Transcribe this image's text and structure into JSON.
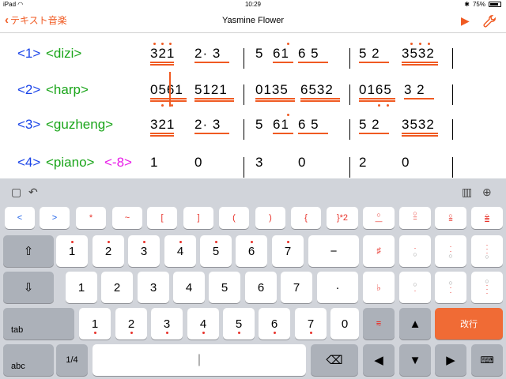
{
  "status": {
    "device": "iPad",
    "wifi": "wifi-icon",
    "time": "10:29",
    "bluetooth": "bluetooth-icon",
    "battery": "75%"
  },
  "nav": {
    "back_label": "テキスト音楽",
    "title": "Yasmine Flower",
    "play_icon": "play-icon",
    "settings_icon": "wrench-icon"
  },
  "accent": "#f05a22",
  "score": {
    "rows": [
      {
        "num": "<1>",
        "name": "<dizi>",
        "extra": "",
        "measures": [
          [
            "321",
            "2· 3"
          ],
          [
            "5",
            "61",
            "6 5"
          ],
          [
            "5 2",
            "3532"
          ]
        ]
      },
      {
        "num": "<2>",
        "name": "<harp>",
        "extra": "",
        "measures": [
          [
            "0561",
            "5121"
          ],
          [
            "0135",
            "6532"
          ],
          [
            "0165",
            "3 2"
          ]
        ]
      },
      {
        "num": "<3>",
        "name": "<guzheng>",
        "extra": "",
        "measures": [
          [
            "321",
            "2· 3"
          ],
          [
            "5",
            "61",
            "6 5"
          ],
          [
            "5 2",
            "3532"
          ]
        ]
      },
      {
        "num": "<4>",
        "name": "<piano>",
        "extra": "<-8>",
        "measures": [
          [
            "1",
            "0"
          ],
          [
            "3",
            "0"
          ],
          [
            "2",
            "0"
          ]
        ]
      }
    ]
  },
  "keyboard": {
    "toolbar": {
      "left1": "speech-bubble-icon",
      "left2": "undo-icon",
      "right1": "piano-keys-icon",
      "right2": "globe-icon"
    },
    "row1": [
      "<",
      ">",
      "*",
      "~",
      "[",
      "]",
      "(",
      ")",
      "{",
      "}*2",
      "",
      "",
      ""
    ],
    "row2": [
      "1",
      "2",
      "3",
      "4",
      "5",
      "6",
      "7",
      "−",
      "♯",
      "",
      "",
      ""
    ],
    "row3": [
      "1",
      "2",
      "3",
      "4",
      "5",
      "6",
      "7",
      "·",
      "♭",
      "",
      "",
      ""
    ],
    "row4": [
      "1",
      "2",
      "3",
      "4",
      "5",
      "6",
      "7",
      "0"
    ],
    "tab_label": "tab",
    "abc_label": "abc",
    "quarter_label": "1/4",
    "enter_label": "改行"
  }
}
